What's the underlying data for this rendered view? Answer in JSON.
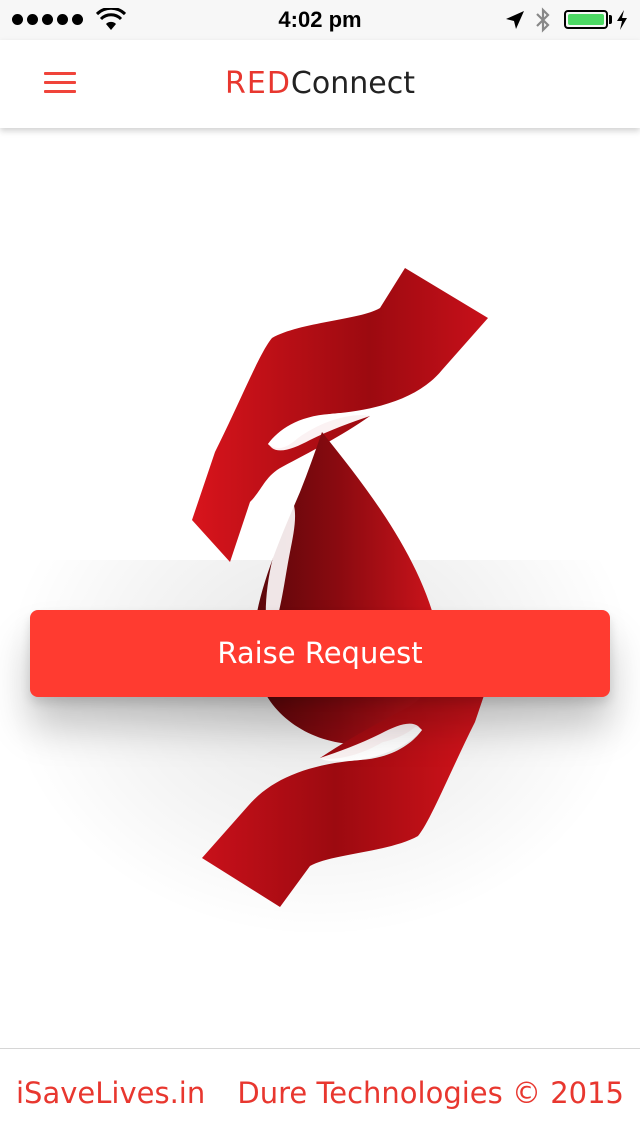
{
  "status_bar": {
    "time": "4:02 pm",
    "signal_dots": 5,
    "battery_level": 1.0,
    "icons": [
      "wifi-icon",
      "location-arrow-icon",
      "bluetooth-icon",
      "battery-icon",
      "charging-bolt-icon"
    ]
  },
  "header": {
    "title_prefix": "RED",
    "title_suffix": "Connect",
    "menu_icon": "hamburger-menu-icon"
  },
  "main": {
    "logo": "hands-holding-blood-drop-logo",
    "raise_button_label": "Raise Request"
  },
  "footer": {
    "left_link": "iSaveLives.in",
    "right_text": "Dure Technologies © 2015"
  },
  "colors": {
    "accent": "#ff3b30",
    "brand_red": "#e8372f",
    "logo_red": "#c8101a",
    "logo_dark": "#7a0a0f",
    "battery_green": "#4cd964"
  }
}
